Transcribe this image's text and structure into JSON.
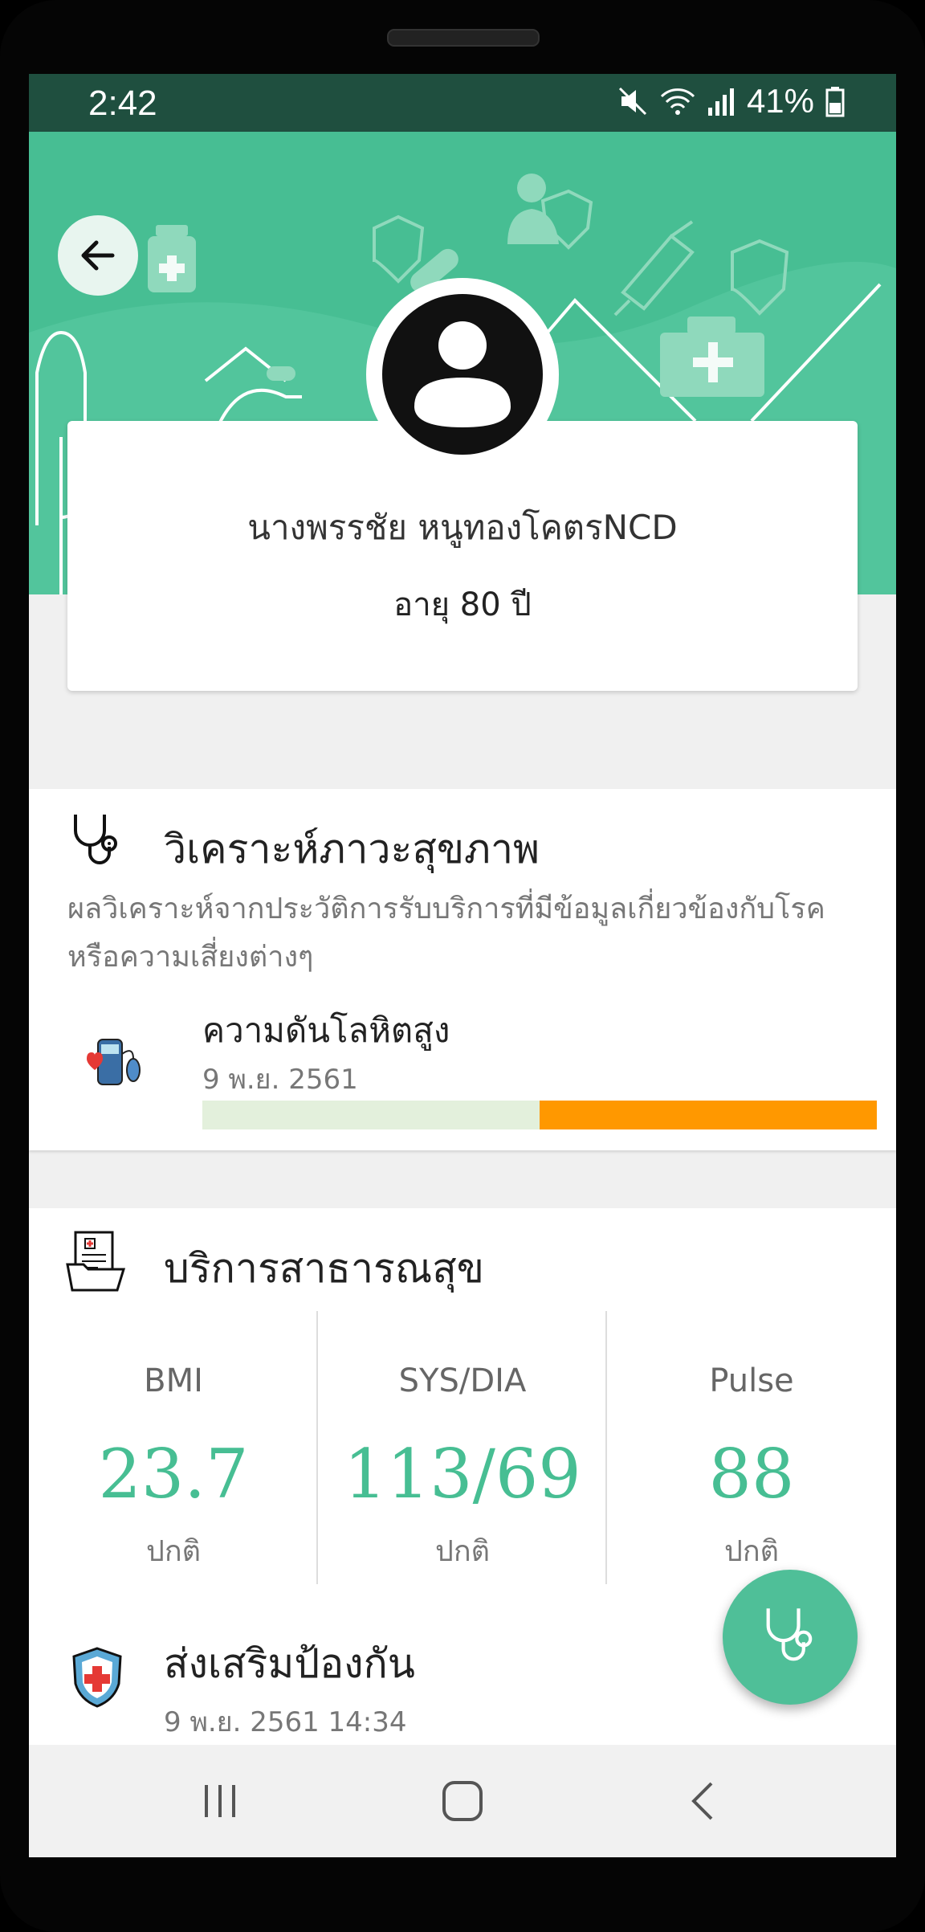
{
  "status_bar": {
    "time": "2:42",
    "battery": "41%"
  },
  "profile": {
    "name": "นางพรรชัย  หนูทองโคตรNCD",
    "age": "อายุ 80 ปี"
  },
  "health_analysis": {
    "title": "วิเคราะห์ภาวะสุขภาพ",
    "description": "ผลวิเคราะห์จากประวัติการรับบริการที่มีข้อมูลเกี่ยวข้องกับโรคหรือความเสี่ยงต่างๆ",
    "condition": {
      "name": "ความดันโลหิตสูง",
      "date": "9 พ.ย. 2561",
      "risk_fraction": 0.5
    }
  },
  "public_health": {
    "title": "บริการสาธารณสุข",
    "stats": [
      {
        "label": "BMI",
        "value": "23.7",
        "status": "ปกติ"
      },
      {
        "label": "SYS/DIA",
        "value": "113/69",
        "status": "ปกติ"
      },
      {
        "label": "Pulse",
        "value": "88",
        "status": "ปกติ"
      }
    ]
  },
  "promotion": {
    "title": "ส่งเสริมป้องกัน",
    "datetime": "9 พ.ย. 2561 14:34"
  },
  "icons": {
    "back": "arrow-left-icon",
    "avatar": "user-avatar-icon",
    "stethoscope": "stethoscope-icon",
    "bp_monitor": "blood-pressure-icon",
    "records": "medical-records-icon",
    "shield": "health-shield-icon",
    "fab": "stethoscope-icon"
  },
  "colors": {
    "primary": "#47be93",
    "status_bar": "#1f4f3f",
    "risk_high": "#ff9800",
    "risk_low": "#e3f0dc"
  }
}
